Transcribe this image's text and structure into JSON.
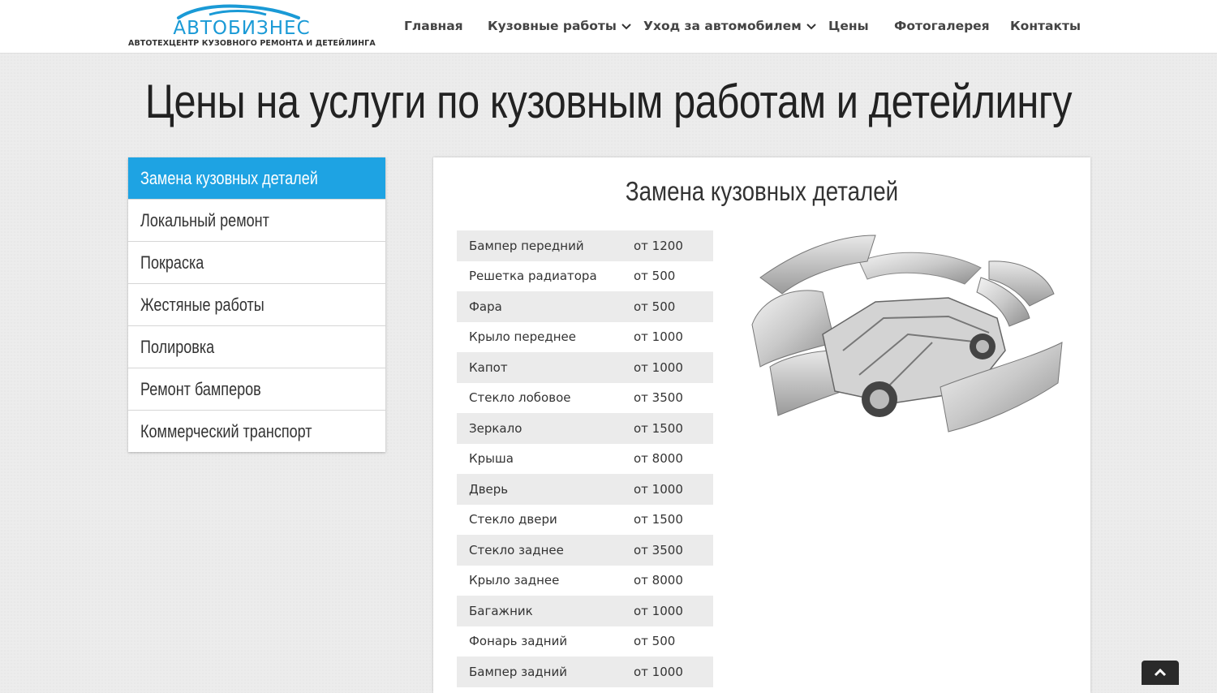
{
  "header": {
    "logo_text": "АВТОБИЗНЕС",
    "logo_tagline": "АВТОТЕХЦЕНТР КУЗОВНОГО РЕМОНТА И ДЕТЕЙЛИНГА",
    "nav": [
      {
        "label": "Главная"
      },
      {
        "label": "Кузовные работы",
        "has_dropdown": true
      },
      {
        "label": "Уход за автомобилем",
        "has_dropdown": true
      },
      {
        "label": "Цены"
      },
      {
        "label": "Фотогалерея"
      },
      {
        "label": "Контакты"
      }
    ]
  },
  "page_title": "Цены на услуги по кузовным работам и детейлингу",
  "sidebar": {
    "items": [
      {
        "label": "Замена кузовных деталей",
        "active": true
      },
      {
        "label": "Локальный ремонт"
      },
      {
        "label": "Покраска"
      },
      {
        "label": "Жестяные работы"
      },
      {
        "label": "Полировка"
      },
      {
        "label": "Ремонт бамперов"
      },
      {
        "label": "Коммерческий транспорт"
      }
    ]
  },
  "panel": {
    "title": "Замена кузовных деталей",
    "prices": [
      {
        "name": "Бампер передний",
        "price": "от 1200"
      },
      {
        "name": "Решетка радиатора",
        "price": "от 500"
      },
      {
        "name": "Фара",
        "price": "от 500"
      },
      {
        "name": "Крыло переднее",
        "price": "от 1000"
      },
      {
        "name": "Капот",
        "price": "от 1000"
      },
      {
        "name": "Стекло лобовое",
        "price": "от 3500"
      },
      {
        "name": "Зеркало",
        "price": "от 1500"
      },
      {
        "name": "Крыша",
        "price": "от 8000"
      },
      {
        "name": "Дверь",
        "price": "от 1000"
      },
      {
        "name": "Стекло двери",
        "price": "от 1500"
      },
      {
        "name": "Стекло заднее",
        "price": "от 3500"
      },
      {
        "name": "Крыло заднее",
        "price": "от 8000"
      },
      {
        "name": "Багажник",
        "price": "от 1000"
      },
      {
        "name": "Фонарь задний",
        "price": "от 500"
      },
      {
        "name": "Бампер задний",
        "price": "от 1000"
      }
    ]
  },
  "icons": {
    "dropdown": "chevron-down-icon",
    "scroll_top": "chevron-up-icon"
  },
  "colors": {
    "accent": "#1ea3e3",
    "logo_blue": "#1a9ad6"
  }
}
